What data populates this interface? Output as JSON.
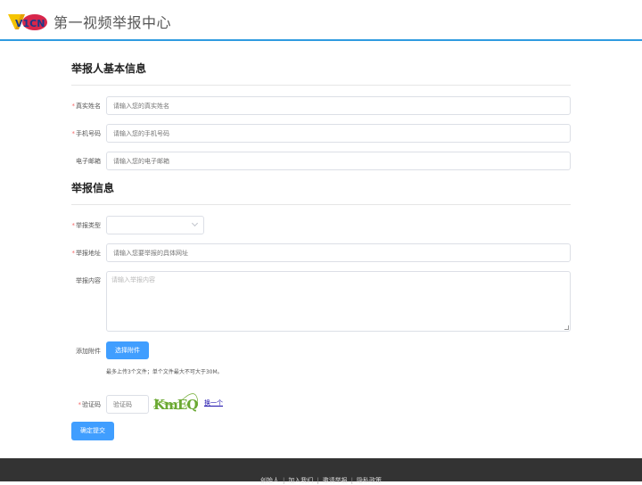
{
  "header": {
    "logo_text": "V1CN",
    "site_title": "第一视频举报中心"
  },
  "reporter_section": {
    "title": "举报人基本信息",
    "fields": [
      {
        "label": "真实姓名",
        "required": "*",
        "placeholder": "请输入您的真实姓名",
        "value": ""
      },
      {
        "label": "手机号码",
        "required": "*",
        "placeholder": "请输入您的手机号码",
        "value": ""
      },
      {
        "label": "电子邮箱",
        "required": "",
        "placeholder": "请输入您的电子邮箱",
        "value": ""
      }
    ]
  },
  "report_section": {
    "title": "举报信息",
    "type": {
      "label": "举报类型",
      "required": "*",
      "selected": ""
    },
    "address": {
      "label": "举报地址",
      "required": "*",
      "placeholder": "请输入您要举报的具体网址",
      "value": ""
    },
    "content": {
      "label": "举报内容",
      "required": "",
      "placeholder": "请输入举报内容",
      "value": ""
    },
    "attachment": {
      "label": "添加附件",
      "button_label": "选择附件",
      "hint": "最多上传3个文件；单个文件最大不可大于30M。"
    },
    "captcha": {
      "label": "验证码",
      "required": "*",
      "placeholder": "验证码",
      "value": "",
      "image_text": "KmEQ",
      "refresh_label": "换一个"
    },
    "submit_label": "确定提交"
  },
  "footer": {
    "links": [
      "创始人",
      "加入我们",
      "邀请举报",
      "隐私政策"
    ]
  },
  "colors": {
    "accent": "#409eff",
    "header_border": "#2f9be0",
    "required": "#f56c6c",
    "footer_bg": "#333333"
  }
}
